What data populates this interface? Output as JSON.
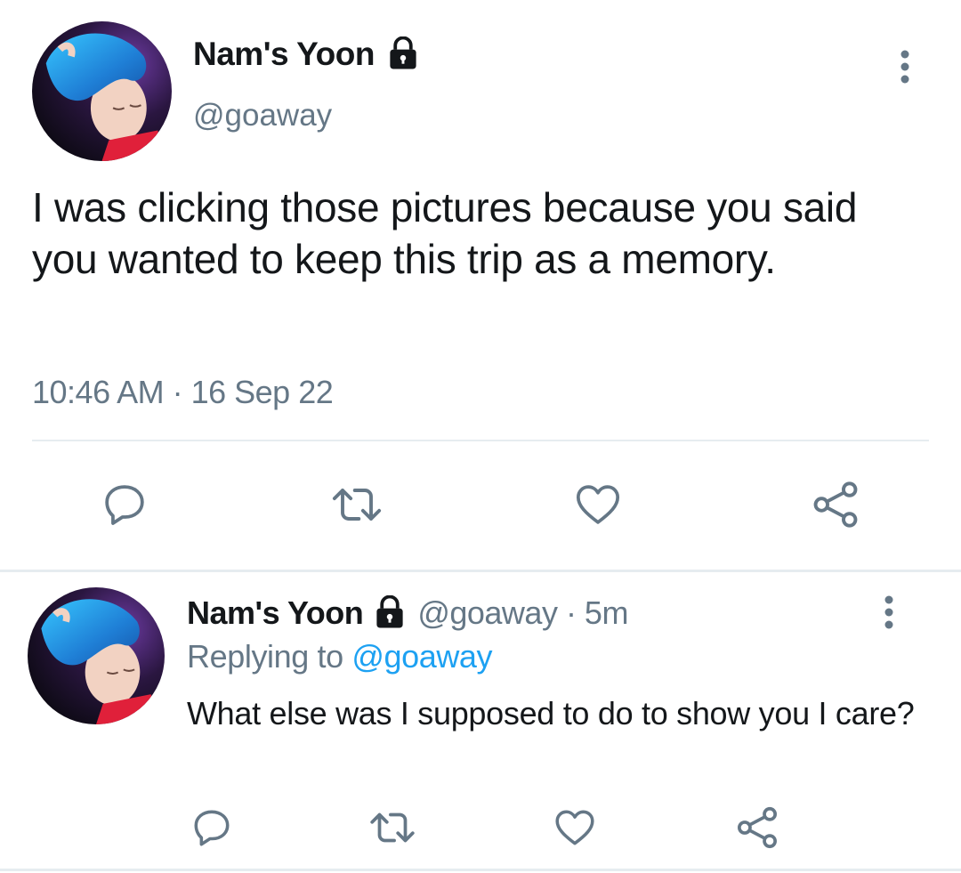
{
  "main_tweet": {
    "display_name": "Nam's Yoon",
    "handle": "@goaway",
    "text": "I was clicking those pictures because you said you wanted to keep this trip as a memory.",
    "timestamp": "10:46 AM · 16 Sep 22",
    "avatar_icon": "profile-photo",
    "lock_icon": "lock-icon",
    "more_icon": "more-vertical-icon"
  },
  "actions": {
    "reply_icon": "reply-icon",
    "retweet_icon": "retweet-icon",
    "like_icon": "heart-icon",
    "share_icon": "share-icon"
  },
  "reply_tweet": {
    "display_name": "Nam's Yoon",
    "meta": "@goaway · 5m",
    "replying_prefix": "Replying to",
    "replying_handle": "@goaway",
    "text": "What else was I supposed to do to show you I care?"
  },
  "colors": {
    "text": "#14171a",
    "secondary": "#657786",
    "link": "#1da1f2",
    "divider": "#e6ecf0",
    "icon": "#657786"
  }
}
